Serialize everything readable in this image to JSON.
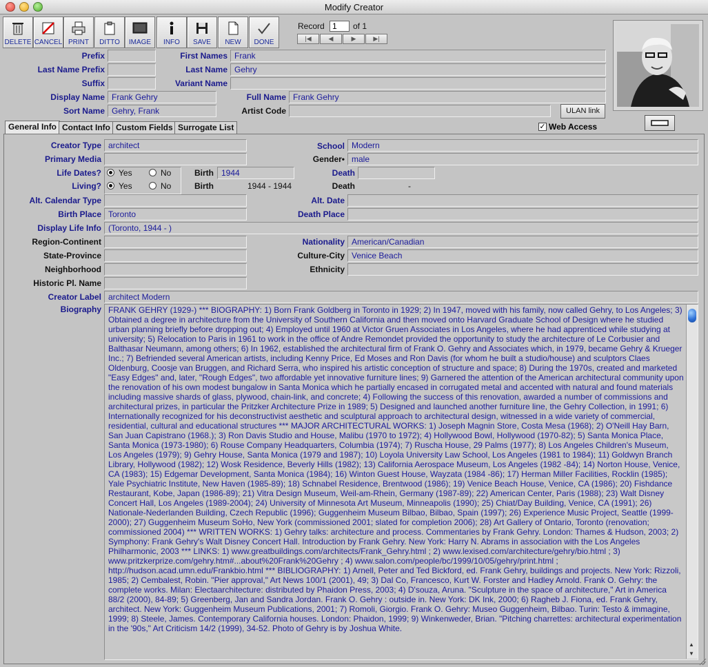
{
  "window": {
    "title": "Modify Creator"
  },
  "toolbar": {
    "delete": "DELETE",
    "cancel": "CANCEL",
    "print": "PRINT",
    "ditto": "DITTO",
    "image": "IMAGE",
    "info": "INFO",
    "save": "SAVE",
    "new": "NEW",
    "done": "DONE"
  },
  "record": {
    "label": "Record",
    "current": "1",
    "of": "of 1",
    "first": "|◀",
    "prev": "◀",
    "next": "▶",
    "last": "▶|"
  },
  "names": {
    "prefix_label": "Prefix",
    "prefix": "",
    "last_name_prefix_label": "Last Name Prefix",
    "last_name_prefix": "",
    "suffix_label": "Suffix",
    "suffix": "",
    "display_name_label": "Display Name",
    "display_name": "Frank Gehry",
    "sort_name_label": "Sort Name",
    "sort_name": "Gehry, Frank",
    "first_names_label": "First Names",
    "first_names": "Frank",
    "last_name_label": "Last Name",
    "last_name": "Gehry",
    "variant_name_label": "Variant Name",
    "variant_name": "",
    "full_name_label": "Full Name",
    "full_name": "Frank Gehry",
    "artist_code_label": "Artist Code",
    "artist_code": "",
    "ulan_link": "ULAN link"
  },
  "tabs": [
    {
      "label": "General Info"
    },
    {
      "label": "Contact Info"
    },
    {
      "label": "Custom Fields"
    },
    {
      "label": "Surrogate List"
    }
  ],
  "web_access": {
    "label": "Web Access",
    "checked": true
  },
  "general": {
    "creator_type_label": "Creator Type",
    "creator_type": "architect",
    "primary_media_label": "Primary Media",
    "primary_media": "",
    "life_dates_label": "Life Dates?",
    "living_label": "Living?",
    "yes": "Yes",
    "no": "No",
    "birth_label": "Birth",
    "birth": "1944",
    "birth2_label": "Birth",
    "birth_range": "1944 - 1944",
    "death_label": "Death",
    "death": "",
    "death2_label": "Death",
    "death_range": "-",
    "school_label": "School",
    "school": "Modern",
    "gender_label": "Gender•",
    "gender": "male",
    "alt_calendar_label": "Alt. Calendar Type",
    "alt_calendar": "",
    "alt_date_label": "Alt. Date",
    "alt_date": "",
    "birth_place_label": "Birth Place",
    "birth_place": "Toronto",
    "death_place_label": "Death Place",
    "death_place": "",
    "display_life_label": "Display Life Info",
    "display_life": "(Toronto, 1944 - )",
    "region_label": "Region-Continent",
    "region": "",
    "nationality_label": "Nationality",
    "nationality": "American/Canadian",
    "state_label": "State-Province",
    "state": "",
    "culture_city_label": "Culture-City",
    "culture_city": "Venice Beach",
    "neighborhood_label": "Neighborhood",
    "neighborhood": "",
    "ethnicity_label": "Ethnicity",
    "ethnicity": "",
    "historic_label": "Historic Pl. Name",
    "historic": "",
    "creator_label_label": "Creator Label",
    "creator_label": "architect Modern",
    "biography_label": "Biography",
    "biography": "FRANK GEHRY (1929-)     ***     BIOGRAPHY: 1) Born Frank Goldberg in Toronto in 1929; 2) In 1947, moved with his family, now called Gehry, to Los Angeles; 3) Obtained a degree in architecture from the University of Southern California and then moved onto Harvard Graduate School of Design where he studied urban planning briefly before dropping out; 4) Employed until 1960 at Victor Gruen Associates in Los Angeles, where he had apprenticed while studying at university; 5) Relocation to Paris in 1961 to work in the office of Andre Remondet provided the opportunity to study the architecture of Le Corbusier and Balthasar Neumann, among others; 6) In 1962, established the architectural firm of Frank O. Gehry and Associates which, in 1979, became Gehry & Krueger Inc.; 7) Befriended several American artists, including Kenny Price, Ed Moses and Ron Davis (for whom he built a studio/house) and sculptors Claes Oldenburg, Coosje van Bruggen, and Richard Serra, who inspired his artistic conception of structure and space; 8) During the 1970s, created and marketed \"Easy Edges\" and, later, \"Rough Edges\", two affordable yet innovative furniture lines; 9) Garnered the attention of the American architectural community upon the renovation of his own modest bungalow in Santa Monica which he partially encased in corrugated metal and accented with natural and found materials including massive shards of glass, plywood, chain-link, and concrete; 4) Following the success of this renovation, awarded  a number of commissions and architectural prizes, in particular the Pritzker Architecture Prize in 1989; 5) Designed and launched another furniture line, the Gehry Collection, in 1991; 6) Internationally recognized for his deconstructivist aesthetic and sculptural approach to architectural design, witnessed in a wide variety of commercial, residential, cultural and educational structures     ***     MAJOR ARCHITECTURAL WORKS: 1) Joseph Magnin Store, Costa Mesa (1968); 2) O'Neill Hay Barn, San Juan Capistrano (1968.); 3) Ron Davis Studio and House, Malibu (1970 to 1972); 4) Hollywood Bowl, Hollywood (1970-82); 5) Santa Monica Place, Santa Monica (1973-1980); 6) Rouse Company Headquarters, Columbia (1974); 7) Ruscha House, 29 Palms (1977); 8) Los Angeles Children's Museum, Los Angeles (1979); 9) Gehry House, Santa Monica (1979 and 1987); 10) Loyola University Law School, Los Angeles (1981 to 1984); 11) Goldwyn Branch Library, Hollywood (1982); 12) Wosk Residence, Beverly Hills (1982); 13) California Aerospace Museum, Los Angeles (1982 -84); 14) Norton House, Venice, CA (1983); 15) Edgemar Development, Santa Monica (1984); 16) Winton Guest House, Wayzata (1984 -86); 17) Herman Miller Facilities, Rocklin (1985); Yale Psychiatric Institute, New Haven (1985-89); 18) Schnabel Residence, Brentwood (1986); 19) Venice Beach House, Venice, CA (1986); 20) Fishdance Restaurant, Kobe, Japan (1986-89); 21) Vitra Design Museum, Weil-am-Rhein, Germany (1987-89); 22) American Center, Paris (1988); 23) Walt Disney Concert Hall, Los Angeles (1989-2004); 24) University of Minnesota Art Museum, Minneapolis (1990); 25) Chiat/Day Building, Venice, CA (1991); 26) Nationale-Nederlanden Building, Czech Republic (1996); Guggenheim Museum Bilbao, Bilbao, Spain (1997); 26) Experience Music Project, Seattle (1999-2000); 27) Guggenheim Museum SoHo, New York (commissioned 2001; slated for completion 2006); 28) Art Gallery of Ontario, Toronto (renovation; commissioned 2004)     ***     WRITTEN WORKS: 1) Gehry talks: architecture and process. Commentaries by Frank Gehry. London: Thames & Hudson, 2003; 2) Symphony: Frank Gehry's Walt Disney Concert Hall. Introduction by Frank Gehry. New York: Harry N. Abrams in association with the Los Angeles Philharmonic, 2003     ***     LINKS: 1) www.greatbuildings.com/architects/Frank_Gehry.html  ; 2) www.lexised.com/architecture/gehry/bio.html  ; 3) www.pritzkerprize.com/gehry.htm#...about%20Frank%20Gehry  ; 4) www.salon.com/people/bc/1999/10/05/gehry/print.html  ; http://hudson.acad.umn.edu/Frankbio.html     ***     BIBLIOGRAPHY: 1) Arnell, Peter and Ted Bickford, ed. Frank Gehry, buildings and projects. New York: Rizzoli, 1985; 2) Cembalest, Robin. \"Pier approval,\" Art News 100/1 (2001), 49; 3) Dal Co, Francesco, Kurt W. Forster and Hadley Arnold. Frank O. Gehry: the complete works. Milan: Electaarchitecture: distributed by Phaidon Press, 2003; 4) D'souza, Aruna. \"Sculpture in the space of architecture,\" Art in America 88/2 (2000), 84-89; 5) Greenberg, Jan and Sandra Jordan. Frank O. Gehry : outside in. New York: DK Ink, 2000; 6) Ragheb J. Fiona, ed. Frank Gehry, architect. New York: Guggenheim Museum Publications, 2001; 7) Romoli, Giorgio. Frank O. Gehry: Museo Guggenheim, Bilbao. Turin: Testo & immagine, 1999; 8) Steele, James. Contemporary California houses. London: Phaidon, 1999; 9) Winkenweder, Brian. \"Pitching charrettes: architectural experimentation in the '90s,\" Art Criticism 14/2 (1999), 34-52. Photo of Gehry is by Joshua White."
  }
}
